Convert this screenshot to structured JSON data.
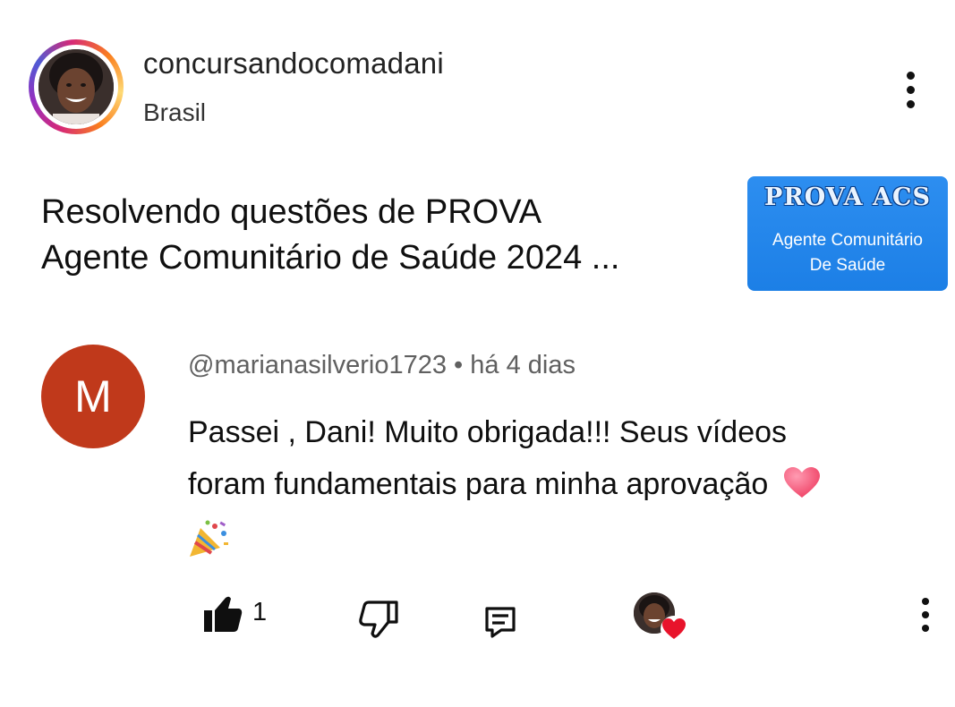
{
  "header": {
    "username": "concursandocomadani",
    "location": "Brasil",
    "menu_icon": "more-vertical-icon"
  },
  "video": {
    "title_line1": "Resolvendo questões de PROVA",
    "title_line2": "Agente Comunitário de Saúde 2024 ...",
    "thumbnail": {
      "heading": "PROVA ACS",
      "sub_line1": "Agente Comunitário",
      "sub_line2": "De Saúde",
      "color": "#2488ee"
    }
  },
  "comment": {
    "avatar_letter": "M",
    "avatar_color": "#c0391b",
    "author": "@marianasilverio1723",
    "separator": "•",
    "time": "há 4 dias",
    "text_line1": "Passei , Dani! Muito obrigada!!! Seus vídeos",
    "text_line2": "foram fundamentais para minha aprovação",
    "emojis": [
      "heart-emoji",
      "party-popper-emoji"
    ]
  },
  "actions": {
    "like_count": "1",
    "icons": [
      "thumbs-up-icon",
      "thumbs-down-icon",
      "reply-icon",
      "creator-heart-icon",
      "more-vertical-icon"
    ]
  }
}
